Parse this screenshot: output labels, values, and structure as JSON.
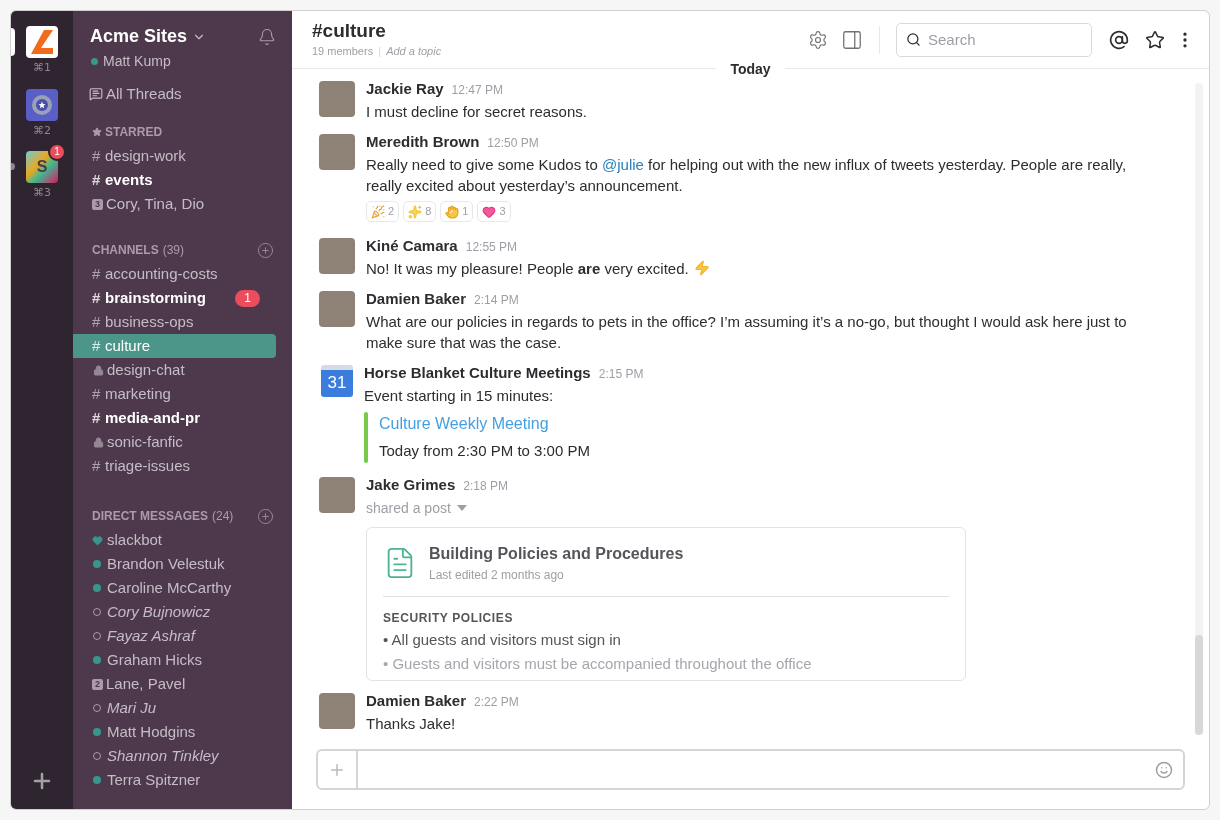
{
  "workspaces": [
    {
      "kind": "angle",
      "shortcut": "⌘1",
      "selected": true,
      "unread": false
    },
    {
      "kind": "star",
      "shortcut": "⌘2",
      "selected": false,
      "unread": false
    },
    {
      "kind": "letter",
      "letter": "S",
      "shortcut": "⌘3",
      "selected": false,
      "unread": true,
      "badge": "1"
    }
  ],
  "team": {
    "name": "Acme Sites",
    "user": "Matt Kump",
    "online": true
  },
  "all_threads": "All Threads",
  "starred": {
    "title": "STARRED",
    "items": [
      {
        "kind": "channel",
        "prefix": "#",
        "name": "design-work",
        "unread": false
      },
      {
        "kind": "channel",
        "prefix": "#",
        "name": "events",
        "unread": true
      },
      {
        "kind": "group",
        "count": "3",
        "name": "Cory, Tina, Dio",
        "unread": false
      }
    ]
  },
  "channels": {
    "title": "CHANNELS",
    "count": "(39)",
    "items": [
      {
        "kind": "channel",
        "prefix": "#",
        "name": "accounting-costs",
        "unread": false,
        "selected": false
      },
      {
        "kind": "channel",
        "prefix": "#",
        "name": "brainstorming",
        "unread": true,
        "selected": false,
        "badge": "1"
      },
      {
        "kind": "channel",
        "prefix": "#",
        "name": "business-ops",
        "unread": false,
        "selected": false
      },
      {
        "kind": "channel",
        "prefix": "#",
        "name": "culture",
        "unread": false,
        "selected": true
      },
      {
        "kind": "private",
        "name": "design-chat",
        "unread": false,
        "selected": false
      },
      {
        "kind": "channel",
        "prefix": "#",
        "name": "marketing",
        "unread": false,
        "selected": false
      },
      {
        "kind": "channel",
        "prefix": "#",
        "name": "media-and-pr",
        "unread": true,
        "selected": false
      },
      {
        "kind": "private",
        "name": "sonic-fanfic",
        "unread": false,
        "selected": false
      },
      {
        "kind": "channel",
        "prefix": "#",
        "name": "triage-issues",
        "unread": false,
        "selected": false
      }
    ]
  },
  "direct_messages": {
    "title": "DIRECT MESSAGES",
    "count": "(24)",
    "items": [
      {
        "kind": "bot",
        "name": "slackbot"
      },
      {
        "kind": "user",
        "name": "Brandon Velestuk",
        "online": true
      },
      {
        "kind": "user",
        "name": "Caroline McCarthy",
        "online": true
      },
      {
        "kind": "user",
        "name": "Cory Bujnowicz",
        "online": false
      },
      {
        "kind": "user",
        "name": "Fayaz Ashraf",
        "online": false
      },
      {
        "kind": "user",
        "name": "Graham Hicks",
        "online": true
      },
      {
        "kind": "group",
        "count": "2",
        "name": "Lane, Pavel"
      },
      {
        "kind": "user",
        "name": "Mari Ju",
        "online": false
      },
      {
        "kind": "user",
        "name": "Matt Hodgins",
        "online": true
      },
      {
        "kind": "user",
        "name": "Shannon Tinkley",
        "online": false
      },
      {
        "kind": "user",
        "name": "Terra Spitzner",
        "online": true
      }
    ]
  },
  "header": {
    "title": "#culture",
    "members": "19 members",
    "topic_placeholder": "Add a topic",
    "search_placeholder": "Search"
  },
  "day_divider": "Today",
  "messages": [
    {
      "author": "Jackie Ray",
      "time": "12:47 PM",
      "avatar": {
        "kind": "photo"
      },
      "body": [
        {
          "kind": "text",
          "text": "I must decline for secret reasons."
        }
      ]
    },
    {
      "author": "Meredith Brown",
      "time": "12:50 PM",
      "avatar": {
        "kind": "photo"
      },
      "body": [
        {
          "kind": "text",
          "text": "Really need to give some Kudos to "
        },
        {
          "kind": "mention",
          "text": "@julie"
        },
        {
          "kind": "text",
          "text": " for helping out with the new influx of tweets yesterday. People are really, really excited about yesterday’s announcement."
        }
      ],
      "reactions": [
        {
          "kind": "party",
          "count": "2"
        },
        {
          "kind": "sparkles",
          "count": "8"
        },
        {
          "kind": "clap",
          "count": "1"
        },
        {
          "kind": "heart",
          "count": "3"
        }
      ]
    },
    {
      "author": "Kiné Camara",
      "time": "12:55 PM",
      "avatar": {
        "kind": "photo"
      },
      "body": [
        {
          "kind": "text",
          "text": "No! It was my pleasure! People **are** very excited."
        },
        {
          "kind": "lightning"
        }
      ]
    },
    {
      "author": "Damien Baker",
      "time": "2:14 PM",
      "avatar": {
        "kind": "photo"
      },
      "body": [
        {
          "kind": "text",
          "text": "What are our policies in regards to pets in the office? I’m assuming it’s a no-go, but thought I would ask here just to make sure that was the case."
        }
      ]
    },
    {
      "author": "Horse Blanket Culture Meetings",
      "time": "2:15 PM",
      "avatar": {
        "kind": "calendar",
        "text": "31"
      },
      "body": [
        {
          "kind": "text",
          "text": "Event starting in 15 minutes:"
        }
      ],
      "attachment": {
        "kind": "event",
        "title": "Culture Weekly Meeting",
        "when": "Today from 2:30 PM to 3:00 PM"
      }
    },
    {
      "author": "Jake Grimes",
      "time": "2:18 PM",
      "avatar": {
        "kind": "photo"
      },
      "subtitle": "shared a post",
      "attachment": {
        "kind": "post",
        "title": "Building Policies and Procedures",
        "meta": "Last edited 2 months ago",
        "section": "SECURITY POLICIES",
        "bullets": [
          {
            "marker": "•",
            "text": "All guests and visitors must sign in",
            "faded": false
          },
          {
            "marker": "•",
            "text": "Guests and visitors must be accompanied throughout the office",
            "faded": true
          }
        ]
      }
    },
    {
      "author": "Damien Baker",
      "time": "2:22 PM",
      "avatar": {
        "kind": "photo"
      },
      "body": [
        {
          "kind": "text",
          "text": "Thanks Jake!"
        }
      ]
    }
  ]
}
